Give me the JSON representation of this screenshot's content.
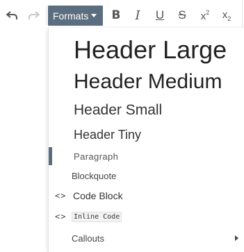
{
  "toolbar": {
    "formats_label": "Formats",
    "bold_label": "B",
    "italic_label": "I",
    "underline_label": "U",
    "strike_label": "S",
    "sup_base": "x",
    "sup_mark": "2",
    "sub_base": "x",
    "sub_mark": "2",
    "icons": [
      "undo-icon",
      "redo-icon",
      "caret-down-icon"
    ]
  },
  "menu": {
    "items": [
      {
        "label": "Header Large"
      },
      {
        "label": "Header Medium"
      },
      {
        "label": "Header Small"
      },
      {
        "label": "Header Tiny"
      },
      {
        "label": "Paragraph",
        "selected": true
      },
      {
        "label": "Blockquote"
      },
      {
        "label": "Code Block",
        "icon": "code-icon",
        "icon_text": "<>"
      },
      {
        "label": "Inline Code",
        "icon": "code-icon",
        "icon_text": "<>"
      },
      {
        "label": "Callouts",
        "icon": "chevron-right-icon"
      }
    ]
  },
  "colors": {
    "accent": "#5b6e7f",
    "text": "#333333",
    "disabled": "#c8c8c8"
  }
}
